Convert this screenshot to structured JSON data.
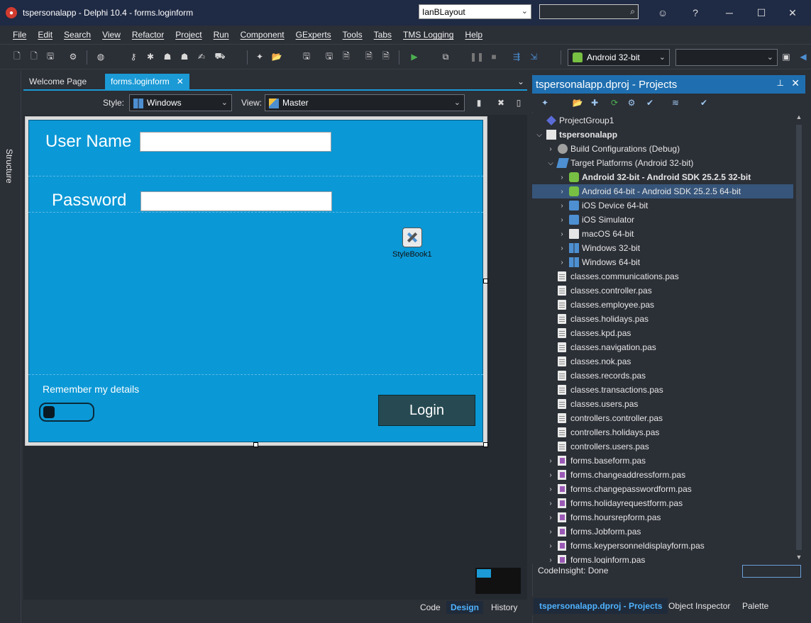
{
  "window": {
    "title": "tspersonalapp - Delphi 10.4 - forms.loginform",
    "layout_selector": "IanBLayout",
    "controls": {
      "help": "?"
    }
  },
  "menu": [
    "File",
    "Edit",
    "Search",
    "View",
    "Refactor",
    "Project",
    "Run",
    "Component",
    "GExperts",
    "Tools",
    "Tabs",
    "TMS Logging",
    "Help"
  ],
  "toolbar": {
    "platform_selected": "Android 32-bit",
    "config_selected": ""
  },
  "left_panel": {
    "structure_tab": "Structure"
  },
  "editor": {
    "tabs": [
      {
        "label": "Welcome Page"
      },
      {
        "label": "forms.loginform"
      }
    ],
    "style_label": "Style:",
    "style_value": "Windows",
    "view_label": "View:",
    "view_value": "Master",
    "bottom_tabs": [
      "Code",
      "Design",
      "History"
    ],
    "active_bottom_tab": "Design"
  },
  "login_form": {
    "username_label": "User Name",
    "username_value": "",
    "password_label": "Password",
    "password_value": "",
    "stylebook_label": "StyleBook1",
    "remember_label": "Remember my details",
    "login_button": "Login"
  },
  "project_panel": {
    "title": "tspersonalapp.dproj - Projects",
    "tree": [
      {
        "label": "ProjectGroup1",
        "icon": "project-group-icon"
      },
      {
        "label": "tspersonalapp",
        "icon": "project-icon",
        "bold": true
      },
      {
        "label": "Build Configurations (Debug)",
        "icon": "gear-icon"
      },
      {
        "label": "Target Platforms (Android 32-bit)",
        "icon": "platforms-icon"
      },
      {
        "label": "Android 32-bit - Android SDK 25.2.5 32-bit",
        "icon": "android-icon",
        "bold": true
      },
      {
        "label": "Android 64-bit - Android SDK 25.2.5 64-bit",
        "icon": "android-icon",
        "selected": true
      },
      {
        "label": "iOS Device 64-bit",
        "icon": "ios-icon"
      },
      {
        "label": "iOS Simulator",
        "icon": "ios-icon"
      },
      {
        "label": "macOS 64-bit",
        "icon": "mac-icon"
      },
      {
        "label": "Windows 32-bit",
        "icon": "windows-icon"
      },
      {
        "label": "Windows 64-bit",
        "icon": "windows-icon"
      },
      {
        "label": "classes.communications.pas",
        "icon": "file-icon"
      },
      {
        "label": "classes.controller.pas",
        "icon": "file-icon"
      },
      {
        "label": "classes.employee.pas",
        "icon": "file-icon"
      },
      {
        "label": "classes.holidays.pas",
        "icon": "file-icon"
      },
      {
        "label": "classes.kpd.pas",
        "icon": "file-icon"
      },
      {
        "label": "classes.navigation.pas",
        "icon": "file-icon"
      },
      {
        "label": "classes.nok.pas",
        "icon": "file-icon"
      },
      {
        "label": "classes.records.pas",
        "icon": "file-icon"
      },
      {
        "label": "classes.transactions.pas",
        "icon": "file-icon"
      },
      {
        "label": "classes.users.pas",
        "icon": "file-icon"
      },
      {
        "label": "controllers.controller.pas",
        "icon": "file-icon"
      },
      {
        "label": "controllers.holidays.pas",
        "icon": "file-icon"
      },
      {
        "label": "controllers.users.pas",
        "icon": "file-icon"
      },
      {
        "label": "forms.baseform.pas",
        "icon": "form-file-icon"
      },
      {
        "label": "forms.changeaddressform.pas",
        "icon": "form-file-icon"
      },
      {
        "label": "forms.changepasswordform.pas",
        "icon": "form-file-icon"
      },
      {
        "label": "forms.holidayrequestform.pas",
        "icon": "form-file-icon"
      },
      {
        "label": "forms.hoursrepform.pas",
        "icon": "form-file-icon"
      },
      {
        "label": "forms.Jobform.pas",
        "icon": "form-file-icon"
      },
      {
        "label": "forms.keypersonneldisplayform.pas",
        "icon": "form-file-icon"
      },
      {
        "label": "forms.loginform.pas",
        "icon": "form-file-icon"
      }
    ],
    "status": "CodeInsight: Done",
    "bottom_tabs": [
      "tspersonalapp.dproj - Projects",
      "Object Inspector",
      "Palette"
    ]
  },
  "colors": {
    "accent": "#1b9ad6",
    "form_background": "#0b98d6",
    "login_button": "#274a52",
    "selection": "#37557a"
  }
}
